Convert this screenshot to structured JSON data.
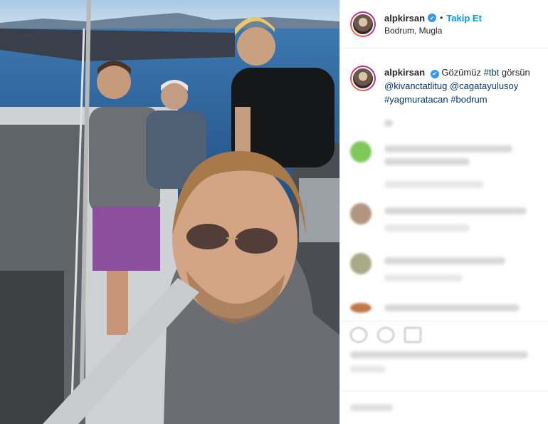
{
  "post": {
    "username": "alpkirsan",
    "verified_mark": "✔",
    "separator": "•",
    "follow_label": "Takip Et",
    "location": "Bodrum, Mugla",
    "caption_plain": "Gözümüz",
    "caption_tag1": "#tbt",
    "caption_word": "görsün",
    "mention1": "@kivanctatlitug",
    "mention2": "@cagatayulusoy",
    "mention3": "#yagmuratacan",
    "caption_tag2": "#bodrum"
  },
  "icons": [
    "verified-badge-icon",
    "heart-icon",
    "comment-icon",
    "share-icon",
    "bookmark-icon"
  ],
  "colors": {
    "link": "#0095f6",
    "hashtag": "#00376b",
    "verified": "#3897f0"
  }
}
